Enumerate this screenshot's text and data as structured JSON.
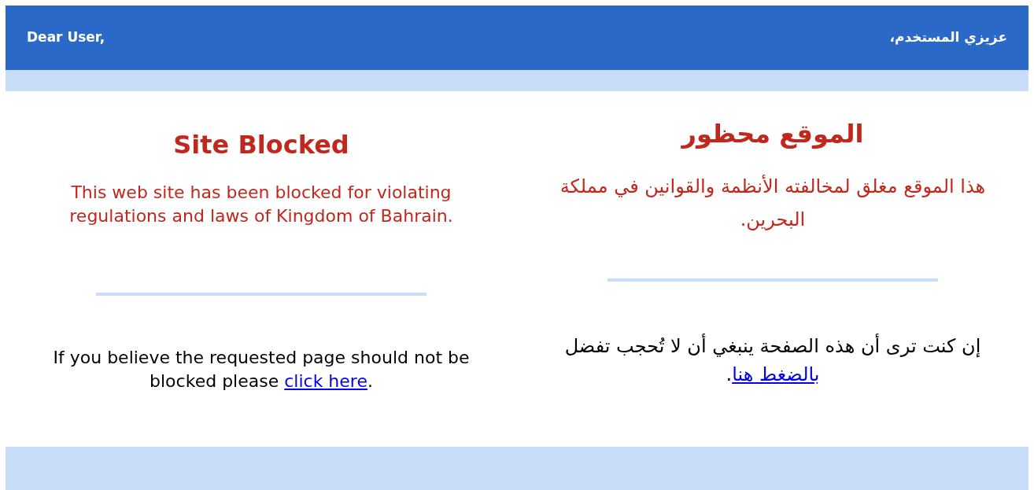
{
  "header": {
    "greeting_en": "Dear User,",
    "greeting_ar": "عزيزي المستخدم،"
  },
  "english_column": {
    "title": "Site Blocked",
    "message": "This web site has been blocked for violating regulations and laws of Kingdom of Bahrain.",
    "note_before": "If you believe the requested page should not be blocked please ",
    "link": "click here",
    "note_after": "."
  },
  "arabic_column": {
    "title": "الموقع محظور",
    "message": "هذا الموقع مغلق لمخالفته الأنظمة والقوانين في مملكة البحرين.",
    "note_before": "إن كنت ترى أن هذه الصفحة ينبغي أن لا تُحجب تفضل ",
    "link": "بالضغط هنا",
    "note_after": "."
  }
}
